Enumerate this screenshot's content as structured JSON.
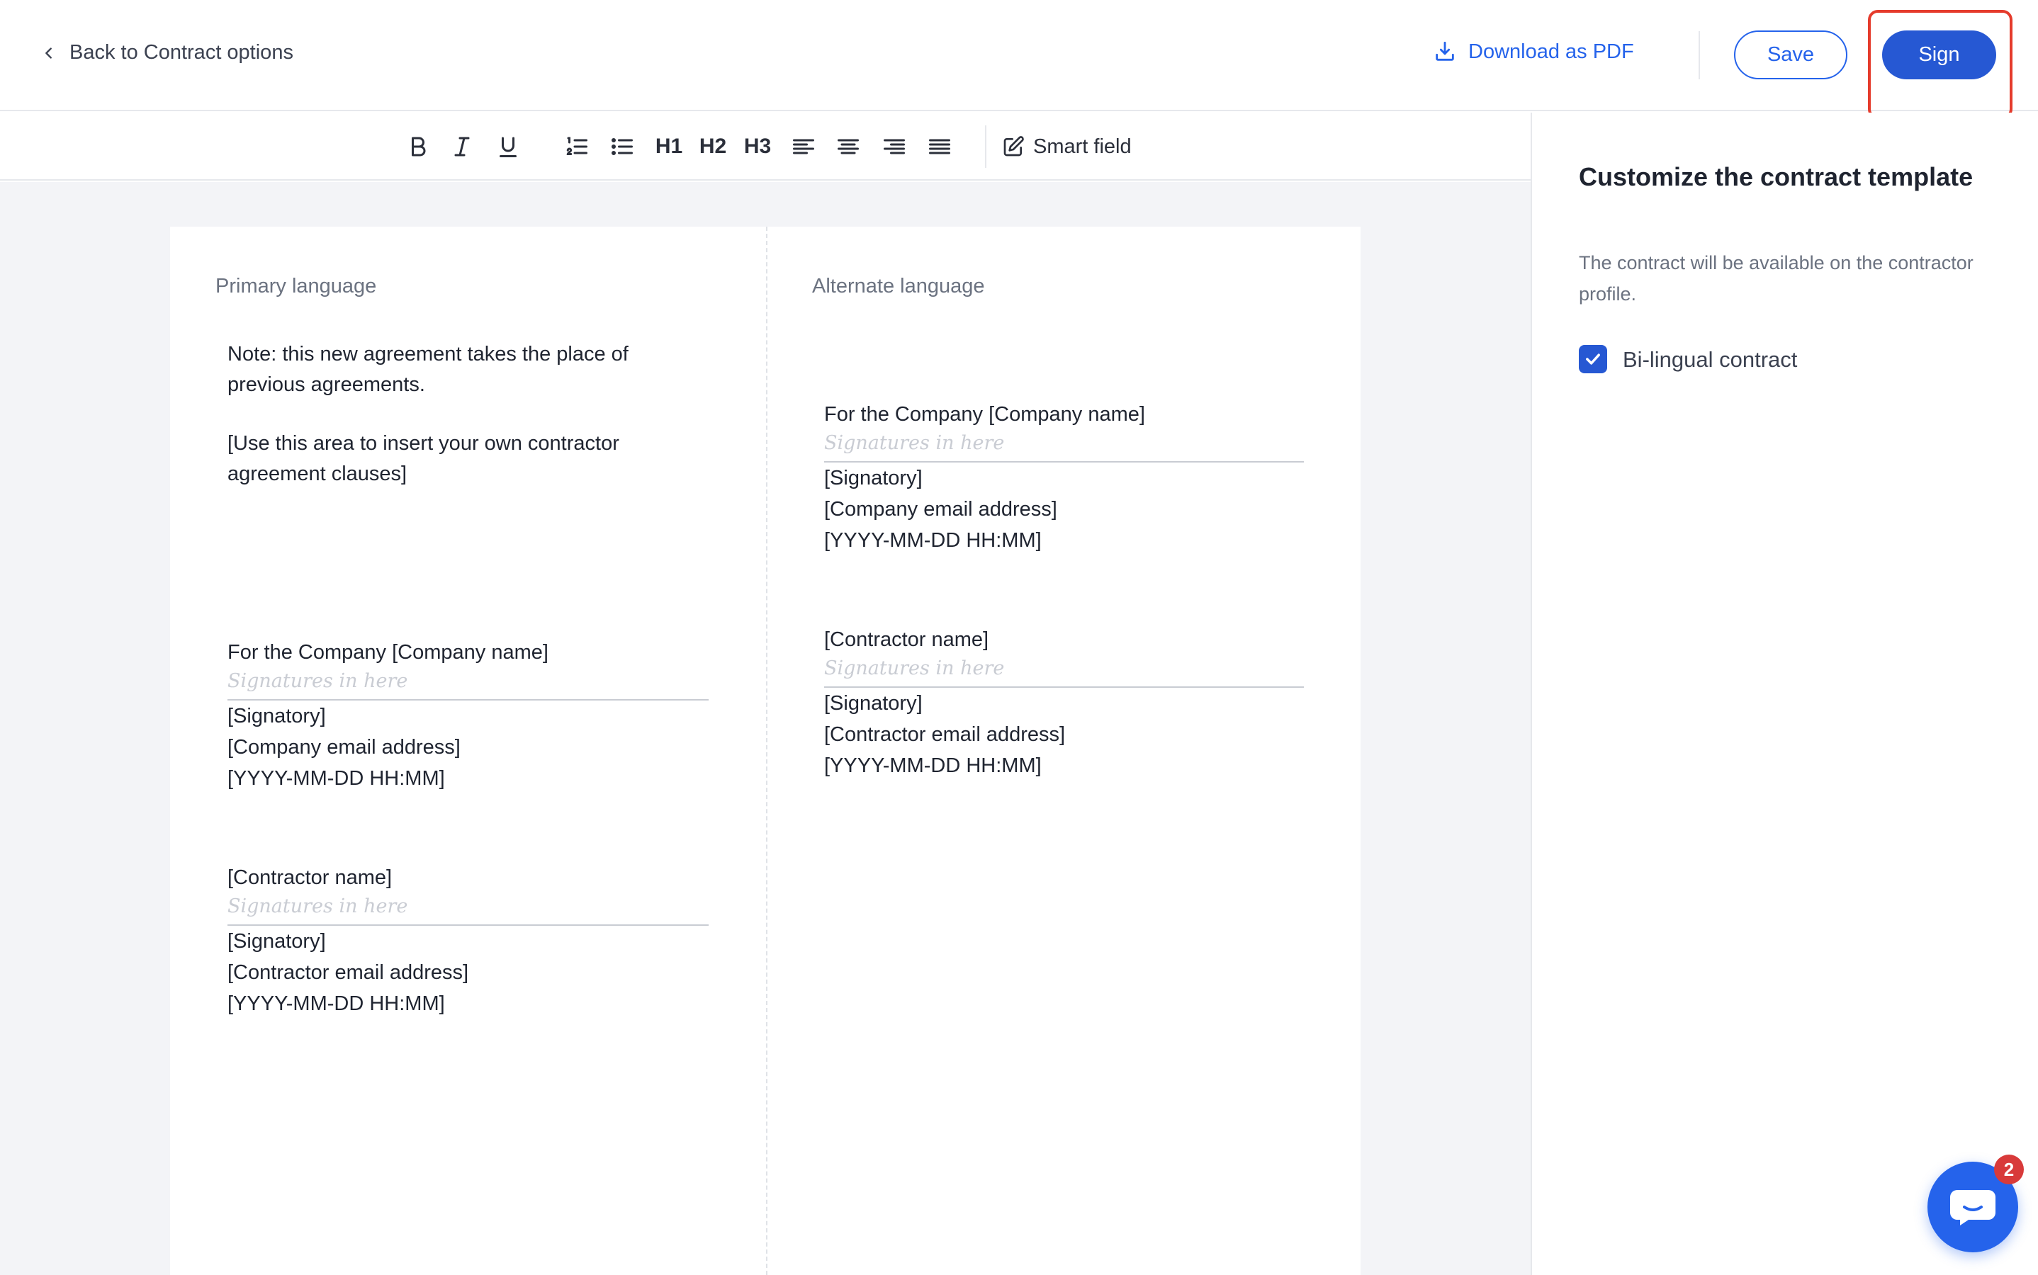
{
  "header": {
    "back_label": "Back to Contract options",
    "download_label": "Download as PDF",
    "save_label": "Save",
    "sign_label": "Sign"
  },
  "toolbar": {
    "h1": "H1",
    "h2": "H2",
    "h3": "H3",
    "smart_field": "Smart field"
  },
  "document": {
    "primary": {
      "label": "Primary language",
      "note": "Note: this new agreement takes the place of previous agreements.",
      "clauses": "[Use this area to insert your own contractor agreement clauses]",
      "company_block": {
        "title": "For the Company [Company name]",
        "signature_placeholder": "Signatures in here",
        "signatory": "[Signatory]",
        "email": "[Company email address]",
        "datetime": "[YYYY-MM-DD HH:MM]"
      },
      "contractor_block": {
        "title": "[Contractor name]",
        "signature_placeholder": "Signatures in here",
        "signatory": "[Signatory]",
        "email": "[Contractor email address]",
        "datetime": "[YYYY-MM-DD HH:MM]"
      }
    },
    "alternate": {
      "label": "Alternate language",
      "company_block": {
        "title": "For the Company [Company name]",
        "signature_placeholder": "Signatures in here",
        "signatory": "[Signatory]",
        "email": "[Company email address]",
        "datetime": "[YYYY-MM-DD HH:MM]"
      },
      "contractor_block": {
        "title": "[Contractor name]",
        "signature_placeholder": "Signatures in here",
        "signatory": "[Signatory]",
        "email": "[Contractor email address]",
        "datetime": "[YYYY-MM-DD HH:MM]"
      }
    }
  },
  "panel": {
    "title": "Customize the contract template",
    "description": "The contract will be available on the contractor profile.",
    "bilingual_label": "Bi-lingual contract",
    "bilingual_checked": true
  },
  "chat": {
    "unread_count": "2"
  },
  "colors": {
    "accent": "#2563eb",
    "sign_button": "#2658d3",
    "highlight": "#e53b2c",
    "badge": "#d83a3a"
  }
}
